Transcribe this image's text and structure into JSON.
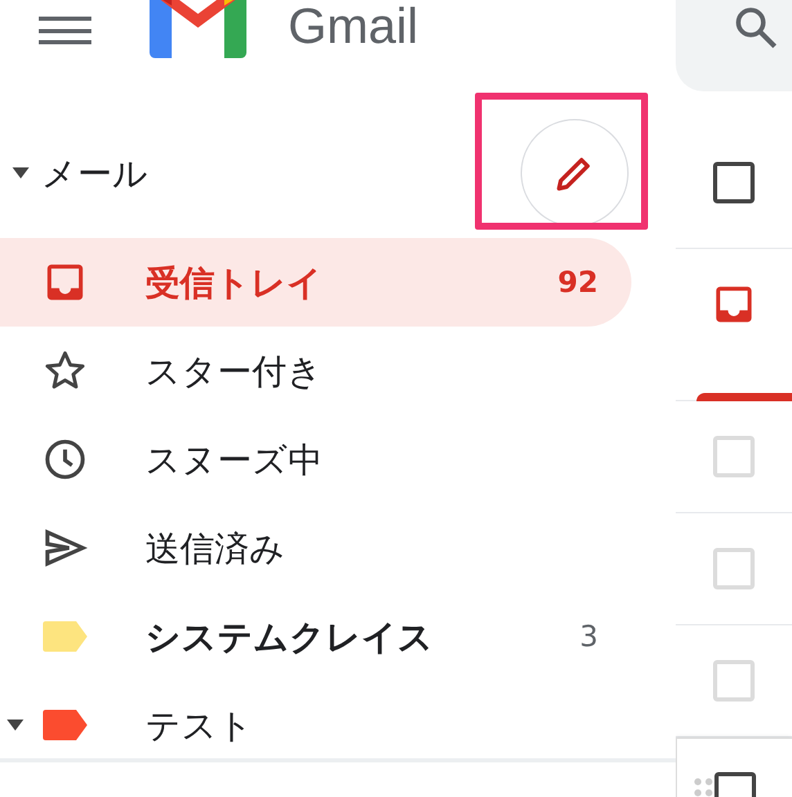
{
  "header": {
    "app_name": "Gmail"
  },
  "mail_section": {
    "label": "メール",
    "expanded": true
  },
  "compose": {
    "highlighted": true
  },
  "nav": [
    {
      "kind": "inbox",
      "label": "受信トレイ",
      "count": "92",
      "selected": true,
      "bold": true
    },
    {
      "kind": "starred",
      "label": "スター付き",
      "selected": false,
      "bold": false
    },
    {
      "kind": "snoozed",
      "label": "スヌーズ中",
      "selected": false,
      "bold": false
    },
    {
      "kind": "sent",
      "label": "送信済み",
      "selected": false,
      "bold": false
    },
    {
      "kind": "label",
      "label": "システムクレイス",
      "count": "3",
      "color": "#fde47f",
      "selected": false,
      "bold": true
    },
    {
      "kind": "label",
      "label": "テスト",
      "color": "#fb4c2f",
      "selected": false,
      "bold": false,
      "expanded": true
    }
  ],
  "message_list": {
    "select_all": {
      "checked": false
    },
    "category_tab": {
      "selected": true
    },
    "rows": [
      {
        "checked": false,
        "hovered": false
      },
      {
        "checked": false,
        "hovered": false
      },
      {
        "checked": false,
        "hovered": false
      },
      {
        "checked": false,
        "hovered": true
      }
    ]
  }
}
